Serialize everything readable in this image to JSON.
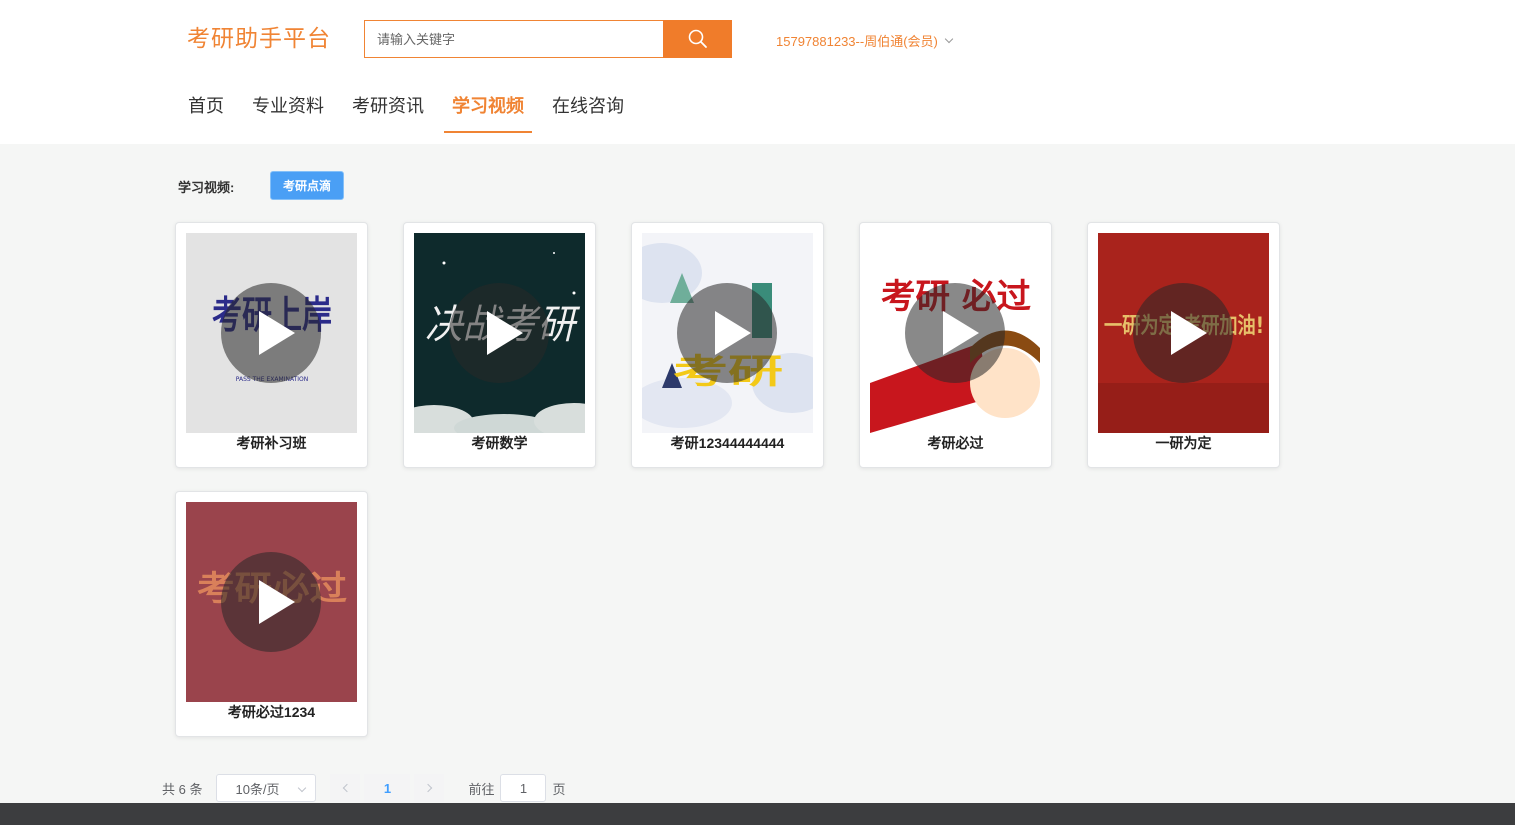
{
  "header": {
    "logo": "考研助手平台",
    "search_placeholder": "请输入关键字",
    "user": "15797881233--周伯通(会员)"
  },
  "nav": {
    "items": [
      "首页",
      "专业资料",
      "考研资讯",
      "学习视频",
      "在线咨询"
    ],
    "active": "学习视频"
  },
  "filter": {
    "label": "学习视频:",
    "tag": "考研点滴"
  },
  "videos": [
    {
      "title": "考研补习班",
      "cover_text": "考研上岸",
      "cover_subtext": "PASS THE EXAMINATION"
    },
    {
      "title": "考研数学",
      "cover_text": "决战考研"
    },
    {
      "title": "考研12344444444",
      "cover_text": "考研"
    },
    {
      "title": "考研必过",
      "cover_text": "考研 必过"
    },
    {
      "title": "一研为定",
      "cover_text": "一研为定 考研加油!"
    },
    {
      "title": "考研必过1234",
      "cover_text": "考研必过"
    }
  ],
  "pagination": {
    "total": "共 6 条",
    "page_size": "10条/页",
    "current_page": "1",
    "goto_prefix": "前往",
    "goto_value": "1",
    "goto_suffix": "页"
  },
  "colors": {
    "accent": "#f08434",
    "tag_blue": "#4a9ff5",
    "page_active": "#409eff",
    "footer": "#3c3d3f"
  },
  "icons": [
    "search-icon",
    "chevron-down-icon",
    "play-icon",
    "chevron-left-icon",
    "chevron-right-icon"
  ]
}
